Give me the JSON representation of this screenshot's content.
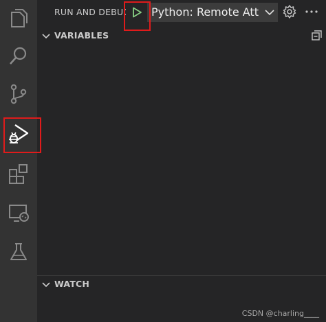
{
  "header": {
    "title": "RUN AND DEBUG",
    "config": "Python: Remote Attach"
  },
  "sections": {
    "variables": "VARIABLES",
    "watch": "WATCH"
  },
  "watermark": "CSDN @charling____",
  "colors": {
    "activity_bar": "#333333",
    "sidebar": "#252526",
    "run_icon": "#89d185",
    "highlight_box": "#e01b1b"
  },
  "icons": {
    "activity_bar": [
      "files-icon",
      "search-icon",
      "source-control-icon",
      "run-debug-icon",
      "extensions-icon",
      "remote-explorer-icon",
      "testing-icon"
    ],
    "header": [
      "play-icon",
      "chevron-down-icon",
      "gear-icon",
      "more-icon"
    ]
  }
}
